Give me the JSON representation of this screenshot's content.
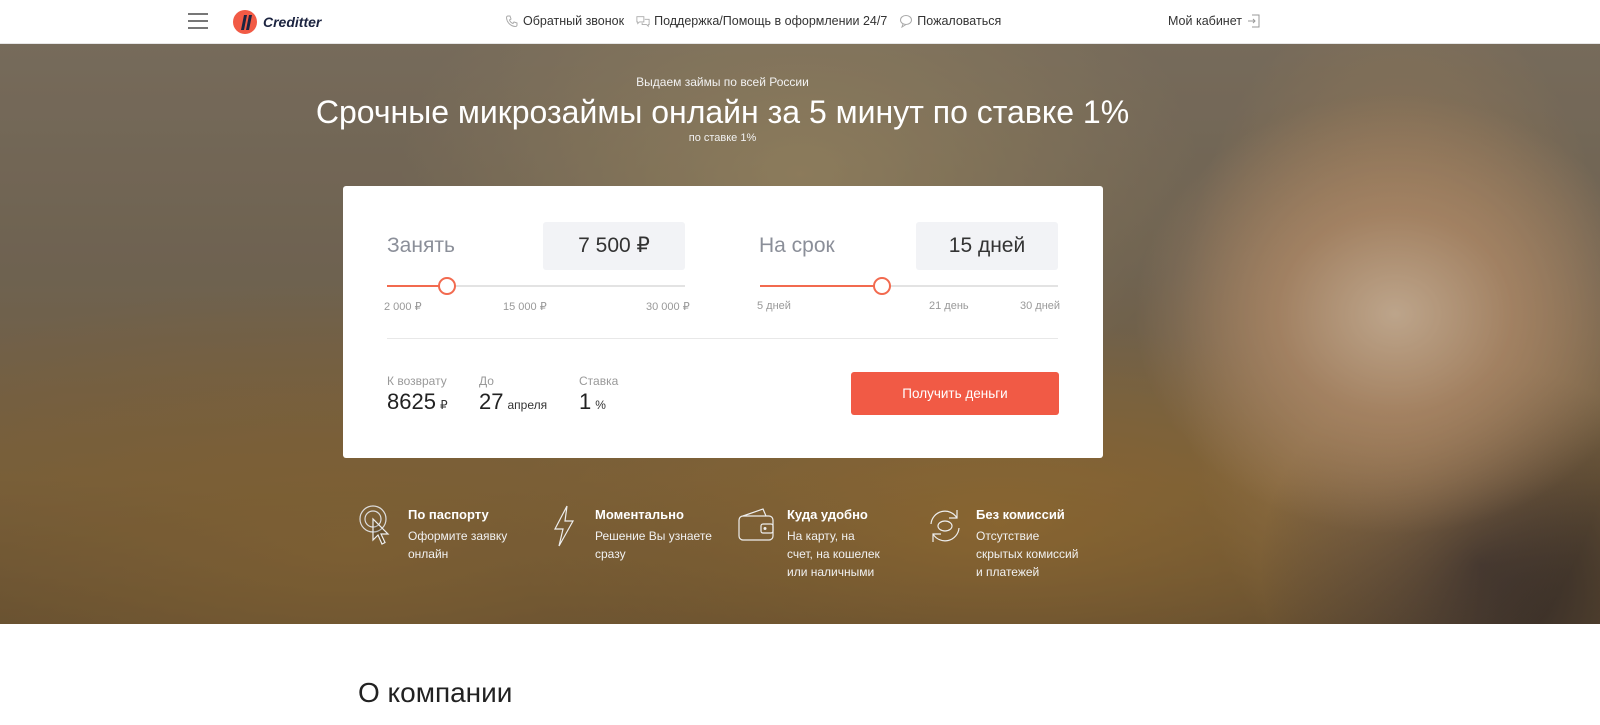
{
  "header": {
    "logo_text": "Creditter",
    "nav": [
      {
        "label": "Обратный звонок",
        "icon": "phone-icon"
      },
      {
        "label": "Поддержка/Помощь в оформлении 24/7",
        "icon": "chat-icon"
      },
      {
        "label": "Пожаловаться",
        "icon": "comment-icon"
      }
    ],
    "cabinet_label": "Мой кабинет"
  },
  "hero": {
    "subtitle": "Выдаем займы по всей России",
    "title": "Срочные микрозаймы онлайн за 5 минут по ставке 1%",
    "title_sub": "по ставке 1%"
  },
  "calculator": {
    "amount": {
      "label": "Занять",
      "value": "7 500 ₽",
      "ticks": [
        "2 000 ₽",
        "15 000 ₽",
        "30 000 ₽"
      ],
      "fraction": 0.2
    },
    "term": {
      "label": "На срок",
      "value": "15 дней",
      "ticks": [
        "5 дней",
        "21 день",
        "30 дней"
      ],
      "fraction": 0.41
    },
    "return": {
      "label": "К возврату",
      "value": "8625",
      "unit": "₽"
    },
    "until": {
      "label": "До",
      "value": "27",
      "unit": "апреля"
    },
    "rate": {
      "label": "Ставка",
      "value": "1",
      "unit": "%"
    },
    "cta_label": "Получить деньги"
  },
  "features": [
    {
      "title": "По паспорту",
      "text": "Оформите заявку онлайн",
      "icon": "pointer-click-icon"
    },
    {
      "title": "Моментально",
      "text": "Решение Вы узнаете сразу",
      "icon": "lightning-icon"
    },
    {
      "title": "Куда удобно",
      "text": "На карту, на счет, на кошелек или наличными",
      "icon": "wallet-icon"
    },
    {
      "title": "Без комиссий",
      "text": "Отсутствие скрытых комиссий и платежей",
      "icon": "refresh-icon"
    }
  ],
  "about_title": "О компании",
  "colors": {
    "accent": "#f15a45",
    "brand_dark": "#1c2440"
  }
}
